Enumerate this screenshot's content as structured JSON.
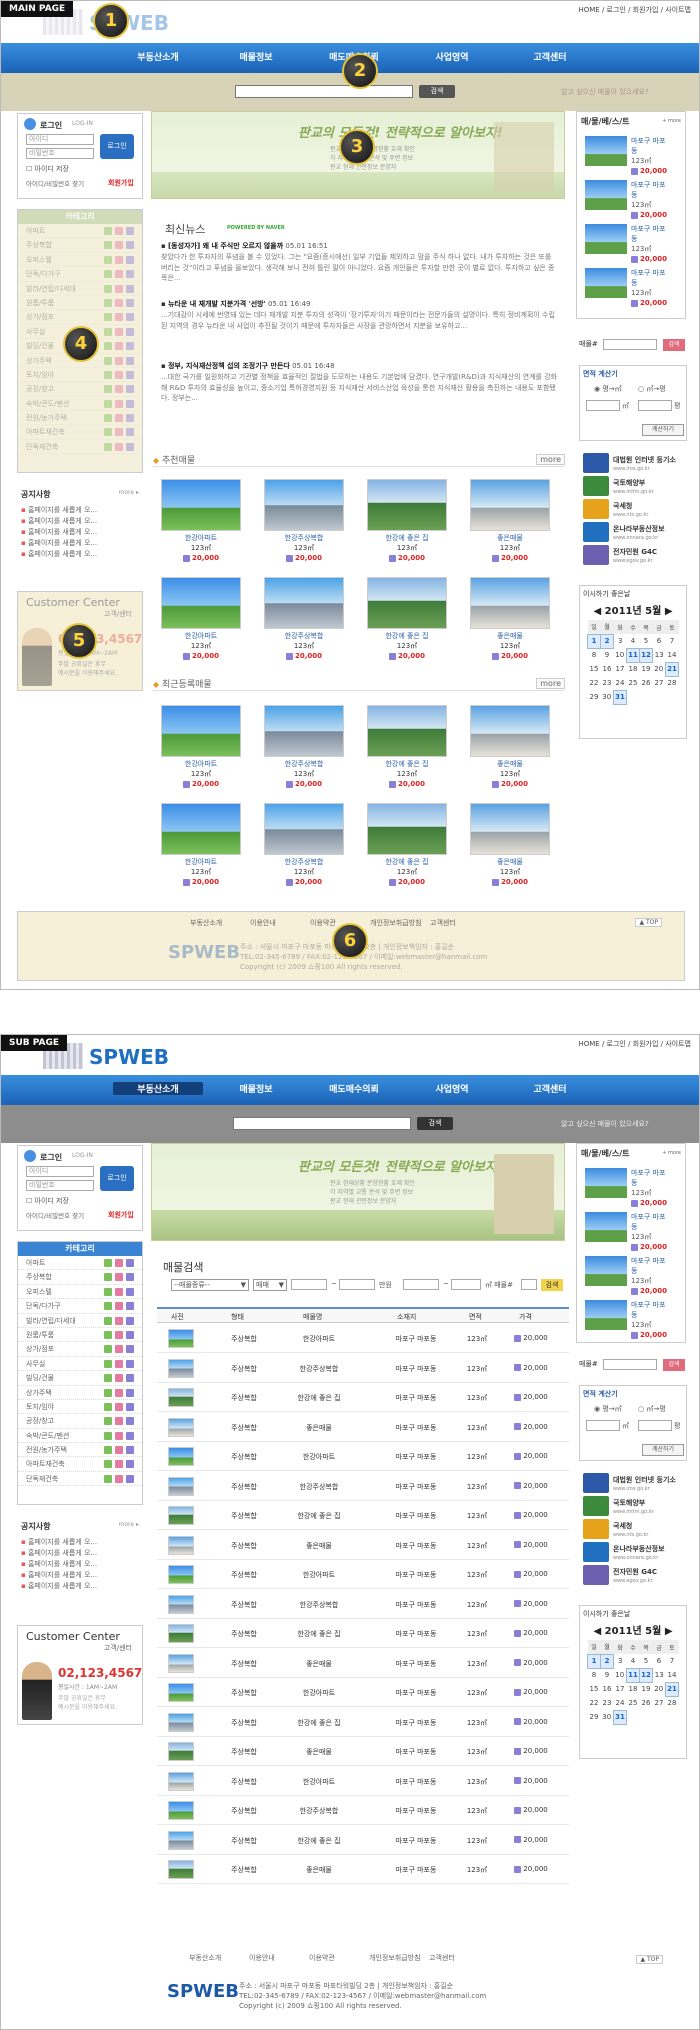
{
  "main": {
    "tag": "MAIN PAGE",
    "toplinks": "HOME / 로그인 / 회원가입 / 사이트맵",
    "logo": "SPWEB",
    "nav": [
      "부동산소개",
      "매물정보",
      "매도매수의뢰",
      "사업영역",
      "고객센터"
    ],
    "search_btn": "검색",
    "promo": "알고 싶으신 매물이 있으세요?",
    "badges": [
      "1",
      "2",
      "3",
      "4",
      "5",
      "6"
    ],
    "login": {
      "title": "로그인",
      "sub": "LOG-IN",
      "id": "아이디",
      "pw": "비밀번호",
      "btn": "로그인",
      "save": "아이디 저장",
      "find": "아이디/비밀번호 찾기",
      "join": "회원가입"
    },
    "category": {
      "title": "카테고리",
      "items": [
        "아파트",
        "주상복합",
        "오피스텔",
        "단독/다가구",
        "빌라/연립/다세대",
        "원룸/투룸",
        "상가/점포",
        "사무실",
        "빌딩/건물",
        "상가주택",
        "토지/임야",
        "공장/창고",
        "숙박/콘도/펜션",
        "전원/농가주택",
        "아파트재건축",
        "단독재건축"
      ]
    },
    "notice": {
      "title": "공지사항",
      "more": "more ▸",
      "items": [
        "홈페이지를 새롭게 오...",
        "홈페이지를 새롭게 오...",
        "홈페이지를 새롭게 오...",
        "홈페이지를 새롭게 오...",
        "홈페이지를 새롭게 오..."
      ]
    },
    "customer": {
      "title": "Customer Center",
      "sub": "고객/센터",
      "num": "02,123,4567",
      "hours": "평일시간 : 1AM~2AM",
      "note1": "주말 공휴일은 휴무",
      "note2": "예시문을 이용해주세요."
    },
    "banner": {
      "head": "판교의 모든것! 전략적으로 알아보자!",
      "l1": "판교 현재상황 분양현황 호재 확인",
      "l2": "각 지역별 교통 분석 및 주변 정보",
      "l3": "판교 현재 관련정보 분양자"
    },
    "news": {
      "title": "최신뉴스",
      "powered": "POWERED BY NAVER",
      "items": [
        {
          "title": "[동성자가] 왜 내 주식만 오르지 않을까",
          "date": "05.01 16:51",
          "body": "찾았다가 한 투자자의 푸념을 볼 수 있었다. 그는 \"요즘(증시에선) 일부 기업들 제외하고 맘을 주식 하나 없다. 내가 투자하는 것은 또를 버리는 것\"이라고 푸념을 올보았다. 생각해 보니 전혀 틀린 말이 아니었다. 요즘 개인들은 투자할 만한 곳이 별로 없다. 투자하고 싶은 종목은..."
        },
        {
          "title": "뉴타운 내 재개발 지분가격 '선방'",
          "date": "05.01 16:49",
          "body": "...기대감이 시세에 반영돼 있는 데다 재개발 지분 투자의 성격이 '장기투자'이기 때문이라는 전문가들의 설명이다. 특히 정비계획이 수립된 지역의 경우 뉴타운 내 사업이 추진될 것이기 때문에 투자자들은 사장을 관망하면서 지분을 보유하고..."
        },
        {
          "title": "정부, 지식재산정책 섭의 조정기구 만든다",
          "date": "05.01 16:48",
          "body": "...대한 국가를 일원화하고 기관별 정책을 효율적인 절법을 도모하는 내용도 기본법에 담겼다. 연구개발(R&D)과 지식재산의 연계를 강화해 R&D 투자의 효율성을 높이고, 중소기업 특허경영지원 등 지식재산 서비스산업 육성을 통한 지식재산 활용을 촉진하는 내용도 포함됐다. 정부는..."
        }
      ]
    },
    "recommend": {
      "title": "추천매물",
      "more": "more"
    },
    "recent": {
      "title": "최근등록매물",
      "more": "more"
    },
    "cards": [
      {
        "name": "한강아파트",
        "area": "123㎡",
        "price": "20,000"
      },
      {
        "name": "한강주상복합",
        "area": "123㎡",
        "price": "20,000"
      },
      {
        "name": "한강에 좋은 집",
        "area": "123㎡",
        "price": "20,000"
      },
      {
        "name": "좋은매물",
        "area": "123㎡",
        "price": "20,000"
      },
      {
        "name": "한강아파트",
        "area": "123㎡",
        "price": "20,000"
      },
      {
        "name": "한강주상복합",
        "area": "123㎡",
        "price": "20,000"
      },
      {
        "name": "한강에 좋은 집",
        "area": "123㎡",
        "price": "20,000"
      },
      {
        "name": "좋은매물",
        "area": "123㎡",
        "price": "20,000"
      }
    ],
    "best": {
      "title": "매/물/베/스/트",
      "more": "+ more",
      "items": [
        {
          "name": "마포구 마포동",
          "area": "123㎡",
          "price": "20,000"
        },
        {
          "name": "마포구 마포동",
          "area": "123㎡",
          "price": "20,000"
        },
        {
          "name": "마포구 마포동",
          "area": "123㎡",
          "price": "20,000"
        },
        {
          "name": "마포구 마포동",
          "area": "123㎡",
          "price": "20,000"
        }
      ]
    },
    "calc": {
      "label": "매물#",
      "btn": "검색",
      "title": "면적 계산기",
      "r1": "평→㎡",
      "r2": "㎡→평",
      "u1": "㎡",
      "u2": "평",
      "calc_btn": "계산하기"
    },
    "links": [
      {
        "t": "대법원 인터넷 등기소",
        "u": "www.iros.go.kr"
      },
      {
        "t": "국토해양부",
        "u": "www.mltm.go.kr"
      },
      {
        "t": "국세청",
        "u": "www.nts.go.kr"
      },
      {
        "t": "온나라부동산정보",
        "u": "www.onnara.go.kr"
      },
      {
        "t": "전자민원 G4C",
        "u": "www.egov.go.kr"
      }
    ],
    "calendar": {
      "title": "이시하기 좋은날",
      "month": "2011년 5월",
      "days": [
        "일",
        "월",
        "화",
        "수",
        "목",
        "금",
        "토"
      ],
      "weeks": [
        [
          "1",
          "2",
          "3",
          "4",
          "5",
          "6",
          "7"
        ],
        [
          "8",
          "9",
          "10",
          "11",
          "12",
          "13",
          "14"
        ],
        [
          "15",
          "16",
          "17",
          "18",
          "19",
          "20",
          "21"
        ],
        [
          "22",
          "23",
          "24",
          "25",
          "26",
          "27",
          "28"
        ],
        [
          "29",
          "30",
          "31",
          "",
          "",
          "",
          ""
        ]
      ]
    },
    "footer": {
      "links": [
        "부동산소개",
        "이용안내",
        "이용약관",
        "개인정보취급방침",
        "고객센터"
      ],
      "top": "▲ TOP",
      "logo": "SPWEB",
      "addr": "주소 : 서울시 마포구 마포동 마포타워빌딩 2층 | 개인정보책임자 : 홍길순",
      "tel": "TEL:02-345-6789 / FAX:02-123-4567 / 이메일:webmaster@hanmail.com",
      "copy": "Copyright (c) 2009 쇼핑100 All rights reserved."
    }
  },
  "sub": {
    "tag": "SUB PAGE",
    "search": {
      "title": "매물검색",
      "sel1": "--매물종류--",
      "sel2": "매매",
      "unit1": "만원",
      "unit2": "㎡ 매물#",
      "btn": "검색"
    },
    "columns": [
      "사진",
      "형태",
      "매물명",
      "소재지",
      "면적",
      "가격"
    ],
    "rows": [
      [
        "주상복합",
        "한강아파트",
        "마포구 마포동",
        "123㎡",
        "20,000"
      ],
      [
        "주상복합",
        "한강주상복합",
        "마포구 마포동",
        "123㎡",
        "20,000"
      ],
      [
        "주상복합",
        "한강에 좋은 집",
        "마포구 마포동",
        "123㎡",
        "20,000"
      ],
      [
        "주상복합",
        "좋은매물",
        "마포구 마포동",
        "123㎡",
        "20,000"
      ],
      [
        "주상복합",
        "한강아파트",
        "마포구 마포동",
        "123㎡",
        "20,000"
      ],
      [
        "주상복합",
        "한강주상복합",
        "마포구 마포동",
        "123㎡",
        "20,000"
      ],
      [
        "주상복합",
        "한강에 좋은 집",
        "마포구 마포동",
        "123㎡",
        "20,000"
      ],
      [
        "주상복합",
        "좋은매물",
        "마포구 마포동",
        "123㎡",
        "20,000"
      ],
      [
        "주상복합",
        "한강아파트",
        "마포구 마포동",
        "123㎡",
        "20,000"
      ],
      [
        "주상복합",
        "한강주상복합",
        "마포구 마포동",
        "123㎡",
        "20,000"
      ],
      [
        "주상복합",
        "한강에 좋은 집",
        "마포구 마포동",
        "123㎡",
        "20,000"
      ],
      [
        "주상복합",
        "좋은매물",
        "마포구 마포동",
        "123㎡",
        "20,000"
      ],
      [
        "주상복합",
        "한강아파트",
        "마포구 마포동",
        "123㎡",
        "20,000"
      ],
      [
        "주상복합",
        "한강에 좋은 집",
        "마포구 마포동",
        "123㎡",
        "20,000"
      ],
      [
        "주상복합",
        "좋은매물",
        "마포구 마포동",
        "123㎡",
        "20,000"
      ],
      [
        "주상복합",
        "한강아파트",
        "마포구 마포동",
        "123㎡",
        "20,000"
      ],
      [
        "주상복합",
        "한강주상복합",
        "마포구 마포동",
        "123㎡",
        "20,000"
      ],
      [
        "주상복합",
        "한강에 좋은 집",
        "마포구 마포동",
        "123㎡",
        "20,000"
      ],
      [
        "주상복합",
        "좋은매물",
        "마포구 마포동",
        "123㎡",
        "20,000"
      ]
    ]
  },
  "colors": {
    "nav": "#1a62b6",
    "accent": "#d22",
    "badge": "#ffd23a"
  }
}
